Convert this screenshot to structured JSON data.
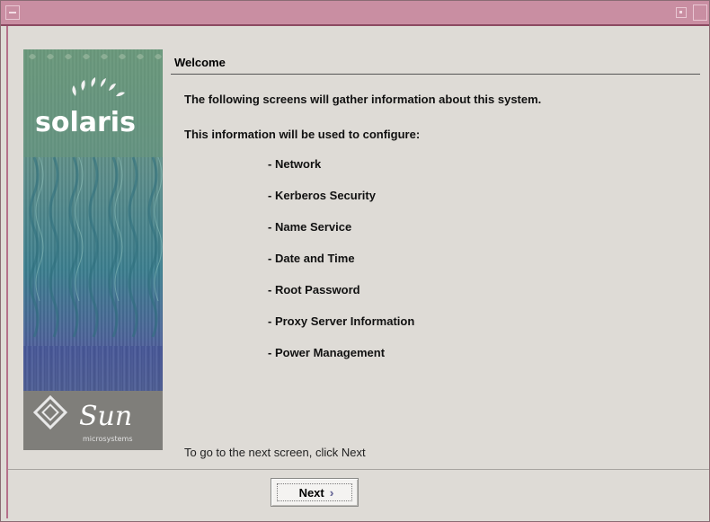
{
  "window": {
    "title": ""
  },
  "banner": {
    "product_logo_text": "solaris",
    "company_logo_text": "Sun",
    "company_logo_subtext": "microsystems"
  },
  "content": {
    "heading": "Welcome",
    "intro": "The following screens will gather information about this system.",
    "intro2": "This information will be used to configure:",
    "items": [
      "Network",
      "Kerberos Security",
      "Name Service",
      "Date and Time",
      "Root Password",
      "Proxy Server Information",
      "Power Management"
    ],
    "hint": "To go to the next screen, click Next"
  },
  "buttons": {
    "next_label": "Next",
    "next_icon": "double-chevron-right-icon"
  },
  "colors": {
    "titlebar": "#c98ea2",
    "titlebar_border": "#8c4a62",
    "background": "#dedbd6"
  }
}
